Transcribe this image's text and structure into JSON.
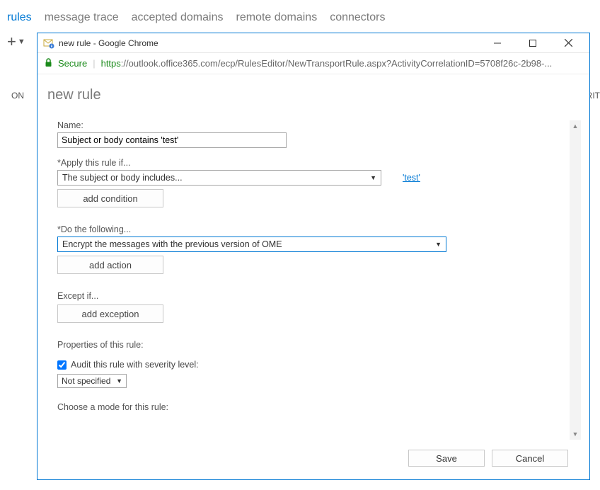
{
  "tabs": {
    "items": [
      "rules",
      "message trace",
      "accepted domains",
      "remote domains",
      "connectors"
    ],
    "active_index": 0
  },
  "background": {
    "on_header": "ON",
    "priority_header_partial": "RIT"
  },
  "popup": {
    "window_title": "new rule - Google Chrome",
    "secure_label": "Secure",
    "url_https": "https",
    "url_host": "://outlook.office365.com",
    "url_path": "/ecp/RulesEditor/NewTransportRule.aspx?ActivityCorrelationID=5708f26c-2b98-...",
    "page_title": "new rule",
    "form": {
      "name_label": "Name:",
      "name_value": "Subject or body contains 'test'",
      "apply_label": "*Apply this rule if...",
      "apply_dropdown": "The subject or body includes...",
      "apply_value_link": "'test'",
      "add_condition_btn": "add condition",
      "do_label": "*Do the following...",
      "do_dropdown": "Encrypt the messages with the previous version of OME",
      "add_action_btn": "add action",
      "except_label": "Except if...",
      "add_exception_btn": "add exception",
      "properties_label": "Properties of this rule:",
      "audit_checkbox_label": "Audit this rule with severity level:",
      "audit_checked": true,
      "severity_value": "Not specified",
      "mode_label": "Choose a mode for this rule:"
    },
    "buttons": {
      "save": "Save",
      "cancel": "Cancel"
    }
  }
}
